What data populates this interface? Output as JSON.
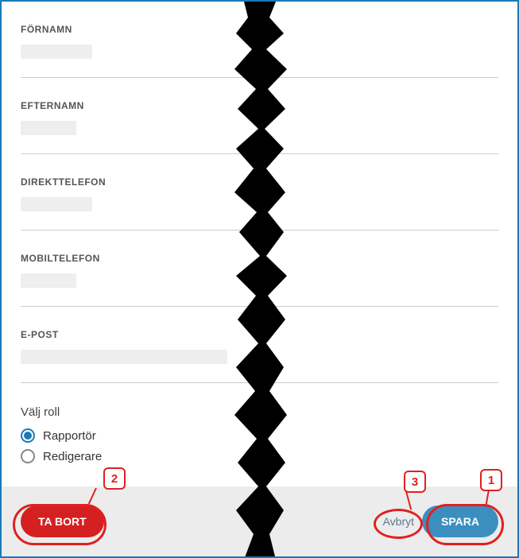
{
  "fields": {
    "firstName": {
      "label": "FÖRNAMN",
      "value": ""
    },
    "lastName": {
      "label": "EFTERNAMN",
      "value": ""
    },
    "directPhone": {
      "label": "DIREKTTELEFON",
      "value": ""
    },
    "mobilePhone": {
      "label": "MOBILTELEFON",
      "value": ""
    },
    "email": {
      "label": "E-POST",
      "value": ""
    }
  },
  "roleSection": {
    "title": "Välj roll",
    "options": [
      {
        "label": "Rapportör",
        "selected": true
      },
      {
        "label": "Redigerare",
        "selected": false
      }
    ]
  },
  "buttons": {
    "delete": "TA BORT",
    "cancel": "Avbryt",
    "save": "SPARA"
  },
  "annotations": {
    "c1": "1",
    "c2": "2",
    "c3": "3"
  }
}
